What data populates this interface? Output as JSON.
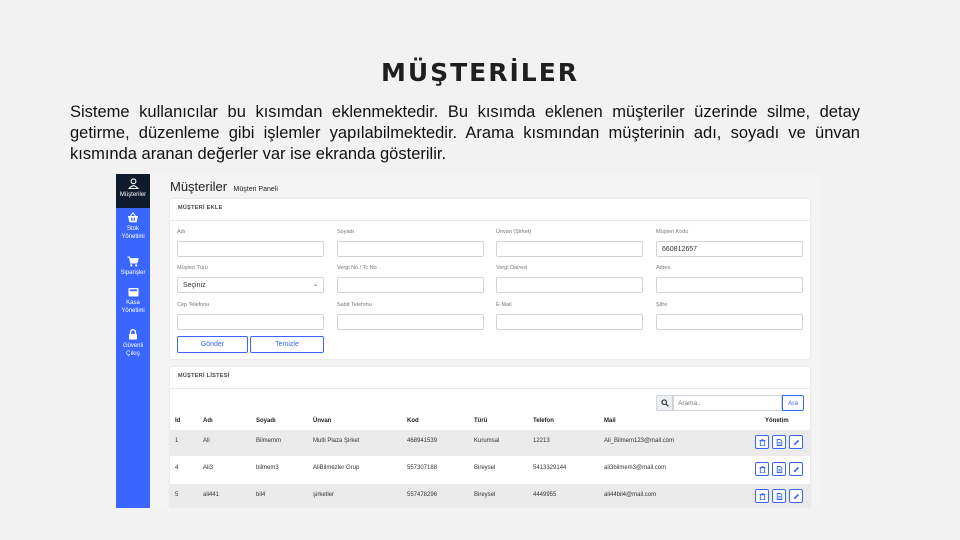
{
  "slide": {
    "title": "MÜŞTERİLER",
    "description": "Sisteme kullanıcılar bu kısımdan eklenmektedir. Bu kısımda eklenen müşteriler üzerinde silme, detay getirme, düzenleme gibi işlemler yapılabilmektedir. Arama kısmından müşterinin adı, soyadı ve ünvan kısmında aranan değerler var ise ekranda gösterilir."
  },
  "colors": {
    "accent": "#3a66ff",
    "sidebar": "#3a66ff",
    "sidebar_active": "#101a2d"
  },
  "sidebar": {
    "items": [
      {
        "icon": "user-icon",
        "label": "Müşteriler"
      },
      {
        "icon": "basket-icon",
        "label1": "Stok",
        "label2": "Yönetimi"
      },
      {
        "icon": "cart-icon",
        "label": "Siparişler"
      },
      {
        "icon": "cash-register-icon",
        "label1": "Kasa",
        "label2": "Yönetimi"
      },
      {
        "icon": "lock-icon",
        "label1": "Güvenli",
        "label2": "Çıkış"
      }
    ]
  },
  "page": {
    "title": "Müşteriler",
    "subtitle": "Müşteri Paneli"
  },
  "form": {
    "header": "MÜŞTERİ EKLE",
    "fields": {
      "ad": {
        "label": "Adı",
        "value": ""
      },
      "soyad": {
        "label": "Soyadı",
        "value": ""
      },
      "unvan": {
        "label": "Ünvan (Şirket)",
        "value": ""
      },
      "kod": {
        "label": "Müşteri Kodu",
        "value": "660812657"
      },
      "tur": {
        "label": "Müşteri Türü",
        "value": "Seçiniz"
      },
      "vergi_no": {
        "label": "Vergi No / Tc No",
        "value": ""
      },
      "vergi_dairesi": {
        "label": "Vergi Dairesi",
        "value": ""
      },
      "adres": {
        "label": "Adres",
        "value": ""
      },
      "cep": {
        "label": "Cep Telefonu",
        "value": ""
      },
      "sabit": {
        "label": "Sabit Telefonu",
        "value": ""
      },
      "email": {
        "label": "E-Mail",
        "value": ""
      },
      "sifre": {
        "label": "Şifre",
        "value": ""
      }
    },
    "submit_label": "Gönder",
    "clear_label": "Temizle"
  },
  "list": {
    "header": "MÜŞTERİ LİSTESİ",
    "search_placeholder": "Arama..",
    "search_button": "Ara",
    "columns": [
      "Id",
      "Adı",
      "Soyadı",
      "Ünvan",
      "Kod",
      "Türü",
      "Telefon",
      "Mail",
      "Yönetim"
    ],
    "rows": [
      [
        "1",
        "Ali",
        "Bilmemm",
        "Multi Plaza Şirket",
        "468941539",
        "Kurumsal",
        "12213",
        "Ali_Bilmem123@mail.com"
      ],
      [
        "4",
        "Ali3",
        "bilmem3",
        "AliBilmezler Grup",
        "557307188",
        "Bireysel",
        "5413329144",
        "ali3bilmem3@mail.com"
      ],
      [
        "5",
        "ali441",
        "bil4",
        "şirketler",
        "557478296",
        "Bireysel",
        "4449955",
        "ali44bil4@mail.com"
      ]
    ]
  }
}
